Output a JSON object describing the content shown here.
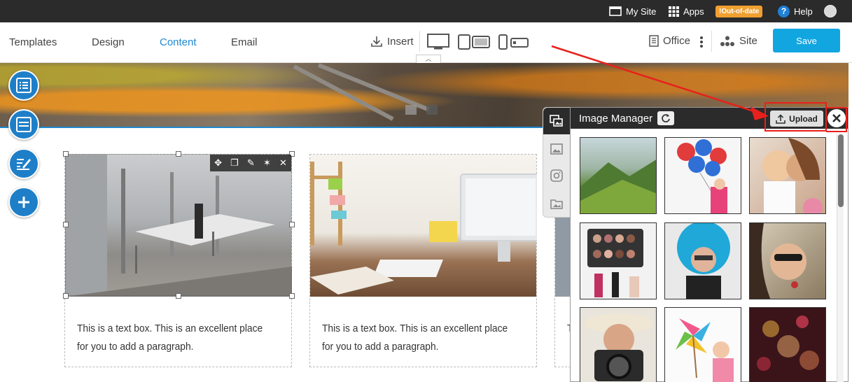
{
  "topbar": {
    "my_site": "My Site",
    "apps": "Apps",
    "badge": "!Out-of-date",
    "help": "Help"
  },
  "toolbar": {
    "tabs": [
      {
        "label": "Templates",
        "active": false
      },
      {
        "label": "Design",
        "active": false
      },
      {
        "label": "Content",
        "active": true
      },
      {
        "label": "Email",
        "active": false
      }
    ],
    "insert": "Insert",
    "office": "Office",
    "site": "Site",
    "save": "Save"
  },
  "cards": [
    {
      "text": "This is a text box. This is an excellent place for you to add a paragraph."
    },
    {
      "text": "This is a text box. This is an excellent place for you to add a paragraph."
    },
    {
      "text": "T f"
    }
  ],
  "image_manager": {
    "title": "Image Manager",
    "upload": "Upload",
    "tabs": [
      "gallery-icon",
      "image-icon",
      "instagram-icon",
      "folder-image-icon"
    ],
    "thumbnails": [
      "green-mountains",
      "balloons-girl",
      "couple-kiss",
      "makeup-palette",
      "blue-afro-man",
      "sunglasses-woman",
      "camera-woman",
      "pinwheel-girl",
      "bokeh-lights"
    ]
  },
  "colors": {
    "accent": "#1e88cf",
    "save": "#12a6e0",
    "badge": "#f0a030",
    "annotation": "#e8201c"
  }
}
